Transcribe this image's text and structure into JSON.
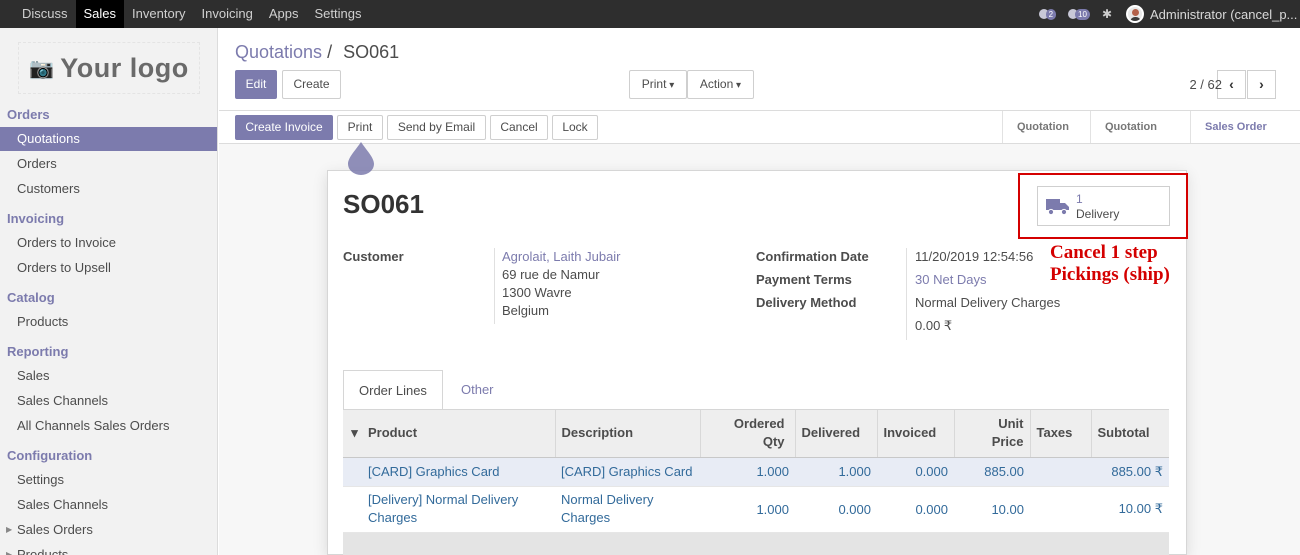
{
  "topbar": {
    "menu": [
      "Discuss",
      "Sales",
      "Inventory",
      "Invoicing",
      "Apps",
      "Settings"
    ],
    "active": "Sales",
    "chat_count": "2",
    "activity_count": "10",
    "user": "Administrator (cancel_p..."
  },
  "sidebar": {
    "logo_text": "Your logo",
    "orders_header": "Orders",
    "orders_items": [
      "Quotations",
      "Orders",
      "Customers"
    ],
    "invoicing_header": "Invoicing",
    "invoicing_items": [
      "Orders to Invoice",
      "Orders to Upsell"
    ],
    "catalog_header": "Catalog",
    "catalog_items": [
      "Products"
    ],
    "reporting_header": "Reporting",
    "reporting_items": [
      "Sales",
      "Sales Channels",
      "All Channels Sales Orders"
    ],
    "configuration_header": "Configuration",
    "configuration_items": [
      "Settings",
      "Sales Channels",
      "Sales Orders",
      "Products"
    ]
  },
  "control": {
    "breadcrumb_parent": "Quotations",
    "breadcrumb_sep": "/",
    "breadcrumb_current": "SO061",
    "edit": "Edit",
    "create": "Create",
    "print": "Print",
    "action": "Action",
    "pager": "2 / 62"
  },
  "statusbar": {
    "buttons": [
      "Create Invoice",
      "Print",
      "Send by Email",
      "Cancel",
      "Lock"
    ],
    "stages": [
      "Quotation",
      "Quotation Sent",
      "Sales Order"
    ],
    "current_stage": "Sales Order"
  },
  "form": {
    "name": "SO061",
    "delivery_count": "1",
    "delivery_label": "Delivery",
    "annotation_line1": "Cancel 1 step",
    "annotation_line2": "Pickings (ship)",
    "customer_label": "Customer",
    "customer_name": "Agrolait, Laith Jubair",
    "address1": "69 rue de Namur",
    "address2": "1300 Wavre",
    "address3": "Belgium",
    "confirmation_label": "Confirmation Date",
    "confirmation_value": "11/20/2019 12:54:56",
    "payment_label": "Payment Terms",
    "payment_value": "30 Net Days",
    "delivery_method_label": "Delivery Method",
    "delivery_method_value": "Normal Delivery Charges",
    "delivery_method_amount": "0.00 ₹"
  },
  "tabs": [
    "Order Lines",
    "Other Information"
  ],
  "order_lines": {
    "headers": [
      "Product",
      "Description",
      "Ordered Qty",
      "Delivered",
      "Invoiced",
      "Unit Price",
      "Taxes",
      "Subtotal"
    ],
    "rows": [
      {
        "product": "[CARD] Graphics Card",
        "description": "[CARD] Graphics Card",
        "qty": "1.000",
        "delivered": "1.000",
        "invoiced": "0.000",
        "price": "885.00",
        "taxes": "",
        "subtotal": "885.00 ₹"
      },
      {
        "product": "[Delivery] Normal Delivery Charges",
        "description": "Normal Delivery Charges",
        "qty": "1.000",
        "delivered": "0.000",
        "invoiced": "0.000",
        "price": "10.00",
        "taxes": "",
        "subtotal": "10.00 ₹"
      }
    ]
  },
  "colors": {
    "brand": "#7c7bad",
    "annotation": "#d40000",
    "topbar": "#2e2e2e"
  }
}
